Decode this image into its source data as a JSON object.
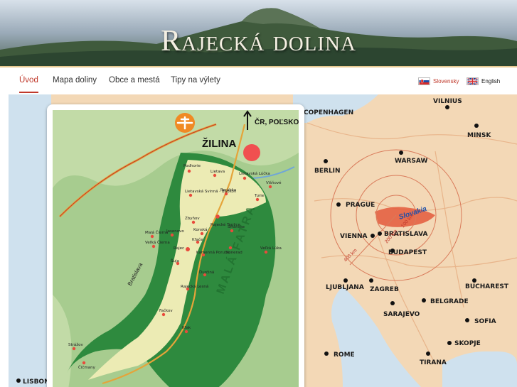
{
  "header": {
    "title": "Rajecká dolina"
  },
  "nav": {
    "items": [
      {
        "label": "Úvod",
        "active": true
      },
      {
        "label": "Mapa doliny",
        "active": false
      },
      {
        "label": "Obce a mestá",
        "active": false
      },
      {
        "label": "Tipy na výlety",
        "active": false
      }
    ],
    "languages": [
      {
        "label": "Slovensky",
        "icon": "slovak-flag-icon",
        "color": "#c0392b"
      },
      {
        "label": "English",
        "icon": "uk-flag-icon",
        "color": "#1a1a1a"
      }
    ]
  },
  "detail_map": {
    "city": "ŽILINA",
    "direction": "ČR, POĽSKO",
    "airport_icon": "airplane-icon",
    "region_label": "MALÁ FATRA",
    "road_label": "Bratislava",
    "villages": [
      "Podhorie",
      "Lietava",
      "Lietavská Lúčka",
      "Višňové",
      "Lietavská Svinná - Babkov",
      "Porúbka",
      "Turie",
      "Zbyňov",
      "Rajecké Teplice",
      "Jasenovo",
      "Konská",
      "Stránske",
      "Kľače",
      "Konerad",
      "Malá Čierna",
      "Veľká Čierna",
      "Rajec",
      "Kamenná Poruba",
      "Veľká Lúka",
      "Šuja",
      "Ďurčiná",
      "Rajecká Lesná",
      "Fačkov",
      "Kľak",
      "Čičmany",
      "Strážov"
    ]
  },
  "europe_map": {
    "cities": [
      "COPENHAGEN",
      "VILNIUS",
      "MINSK",
      "BERLIN",
      "WARSAW",
      "PRAGUE",
      "VIENNA",
      "BRATISLAVA",
      "BUDAPEST",
      "LJUBLJANA",
      "ZAGREB",
      "BUCHAREST",
      "BELGRADE",
      "SARAJEVO",
      "SOFIA",
      "SKOPJE",
      "ROME",
      "TIRANA",
      "LISBON"
    ],
    "country_label": "Slovakia",
    "distances": [
      "100 km",
      "200 km",
      "400 km"
    ]
  },
  "colors": {
    "accent": "#c0392b",
    "land": "#f2d7b5",
    "sea": "#d6e6f2",
    "forest": "#2e8a3e",
    "valley": "#e8e4a8"
  }
}
